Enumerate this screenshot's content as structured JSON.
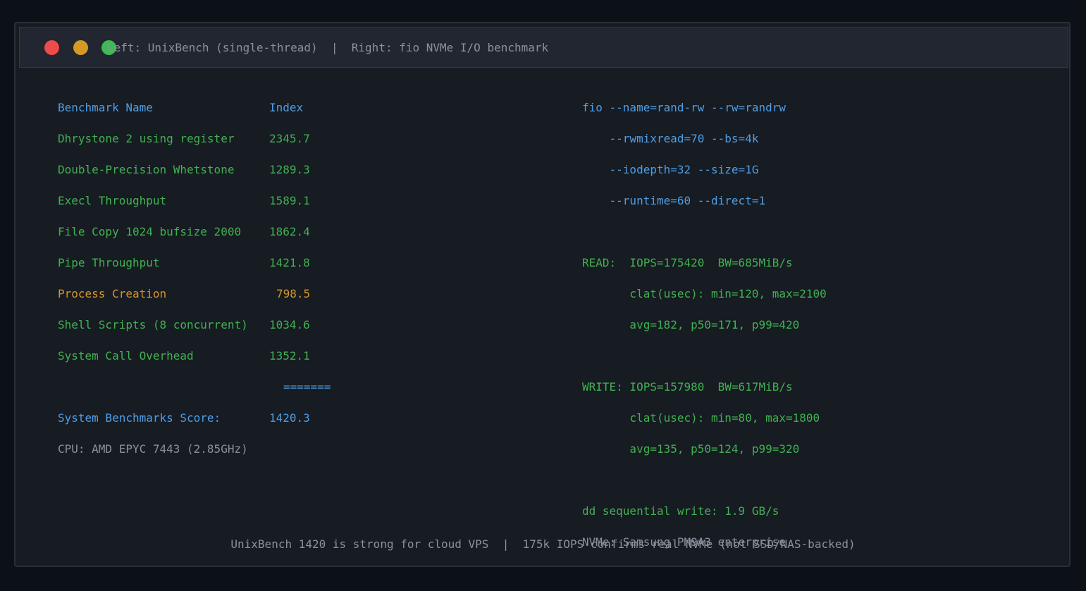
{
  "window": {
    "title": "Left: UnixBench (single-thread)  |  Right: fio NVMe I/O benchmark",
    "footer": "UnixBench 1420 is strong for cloud VPS  |  175k IOPS confirms real NVMe (not SSD/NAS-backed)"
  },
  "colors": {
    "blue": "#4e9ee6",
    "green": "#3fb251",
    "orange": "#d4962a",
    "gray": "#8b929c",
    "close": "#ee4b4b",
    "minimize": "#d59a25",
    "maximize": "#3dbb52"
  },
  "unixbench": {
    "header": {
      "name": "Benchmark Name",
      "index": "Index"
    },
    "rows": [
      {
        "name": "Dhrystone 2 using register",
        "index": "2345.7"
      },
      {
        "name": "Double-Precision Whetstone",
        "index": "1289.3"
      },
      {
        "name": "Execl Throughput",
        "index": "1589.1"
      },
      {
        "name": "File Copy 1024 bufsize 2000",
        "index": "1862.4"
      },
      {
        "name": "Pipe Throughput",
        "index": "1421.8"
      },
      {
        "name": "Process Creation",
        "index": "798.5"
      },
      {
        "name": "Shell Scripts (8 concurrent)",
        "index": "1034.6"
      },
      {
        "name": "System Call Overhead",
        "index": "1352.1"
      }
    ],
    "separator": "=======",
    "score_label": "System Benchmarks Score:",
    "score_value": "1420.3",
    "cpu": "CPU: AMD EPYC 7443 (2.85GHz)"
  },
  "fio": {
    "command": [
      "fio --name=rand-rw --rw=randrw",
      "    --rwmixread=70 --bs=4k",
      "    --iodepth=32 --size=1G",
      "    --runtime=60 --direct=1"
    ],
    "read": {
      "summary": "READ:  IOPS=175420  BW=685MiB/s",
      "clat": "       clat(usec): min=120, max=2100",
      "stats": "       avg=182, p50=171, p99=420"
    },
    "write": {
      "summary": "WRITE: IOPS=157980  BW=617MiB/s",
      "clat": "       clat(usec): min=80, max=1800",
      "stats": "       avg=135, p50=124, p99=320"
    },
    "dd": "dd sequential write: 1.9 GB/s",
    "nvme": "NVMe: Samsung PM9A3 enterprise"
  }
}
